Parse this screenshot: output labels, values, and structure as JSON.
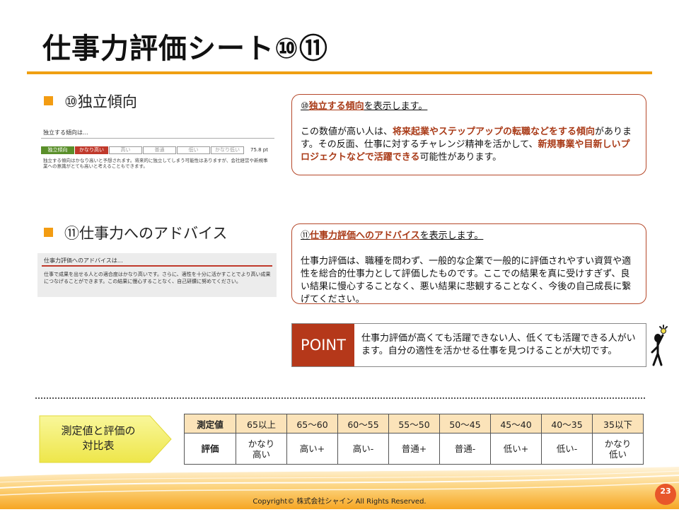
{
  "title": "仕事力評価シート⑩⑪",
  "section10": {
    "heading": "⑩独立傾向",
    "mini": {
      "caption": "独立する傾向は…",
      "scale": [
        "独立傾向",
        "かなり高い",
        "高い",
        "普通",
        "低い",
        "かなり低い"
      ],
      "score": "75.8 pt",
      "description": "独立する傾向はかなり高いと予想されます。将来的に独立してしまう可能性はありますが、会社経営や新規事業への意識がとても高いと考えることもできます。"
    },
    "callout": {
      "prefix": "⑩",
      "link": "独立する傾向",
      "suffix": "を表示します。",
      "body_1": "この数値が高い人は、",
      "em_1": "将来起業やステップアップの転職などをする傾向",
      "body_2": "があります。その反面、仕事に対するチャレンジ精神を活かして、",
      "em_2": "新規事業や目新しいプロジェクトなどで活躍できる",
      "body_3": "可能性があります。"
    }
  },
  "section11": {
    "heading": "⑪仕事力へのアドバイス",
    "mini": {
      "caption": "仕事力評価へのアドバイスは…",
      "description": "仕事で成果を出せる人との適合度はかなり高いです。さらに、適性を十分に活かすことでより高い成果につなげることができます。この結果に慢心することなく、自己研鑽に努めてください。"
    },
    "callout": {
      "prefix": "⑪",
      "link": "仕事力評価へのアドバイス",
      "suffix": "を表示します。",
      "body": "仕事力評価は、職種を問わず、一般的な企業で一般的に評価されやすい資質や適性を総合的仕事力として評価したものです。ここでの結果を真に受けすぎず、良い結果に慢心することなく、悪い結果に悲観することなく、今後の自己成長に繋げてください。"
    }
  },
  "point": {
    "label": "POINT",
    "text": "仕事力評価が高くても活躍できない人、低くても活躍できる人がいます。自分の適性を活かせる仕事を見つけることが大切です。"
  },
  "comparison": {
    "label_line1": "測定値と評価の",
    "label_line2": "対比表",
    "row1_header": "測定値",
    "row2_header": "評価",
    "ranges": [
      "65以上",
      "65〜60",
      "60〜55",
      "55〜50",
      "50〜45",
      "45〜40",
      "40〜35",
      "35以下"
    ],
    "ratings": [
      "かなり\n高い",
      "高い+",
      "高い-",
      "普通+",
      "普通-",
      "低い+",
      "低い-",
      "かなり\n低い"
    ]
  },
  "footer": {
    "copyright": "Copyright© 株式会社シャイン All Rights Reserved.",
    "page_number": "23"
  },
  "colors": {
    "accent_orange": "#f0a012",
    "emphasis_red": "#a93a17",
    "point_bg": "#b5381a",
    "arrow_yellow": "#f4ef5a"
  }
}
